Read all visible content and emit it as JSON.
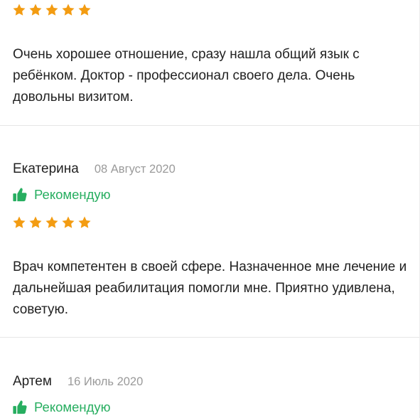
{
  "colors": {
    "accent_green": "#27ae60",
    "star_orange": "#f39c12",
    "muted_date": "#9a9a9a",
    "divider": "#e6e6e6"
  },
  "icons": {
    "recommend": "thumbs-up-icon",
    "rating": "star-icon"
  },
  "reviews": [
    {
      "rating": 5,
      "text": "Очень хорошее отношение, сразу нашла общий язык с ребёнком. Доктор - профессионал своего дела. Очень довольны визитом."
    },
    {
      "author": "Екатерина",
      "date": "08 Август 2020",
      "recommend_label": "Рекомендую",
      "rating": 5,
      "text": "Врач компетентен в своей сфере. Назначенное мне лечение и дальнейшая реабилитация помогли мне. Приятно удивлена, советую."
    },
    {
      "author": "Артем",
      "date": "16 Июль 2020",
      "recommend_label": "Рекомендую"
    }
  ]
}
